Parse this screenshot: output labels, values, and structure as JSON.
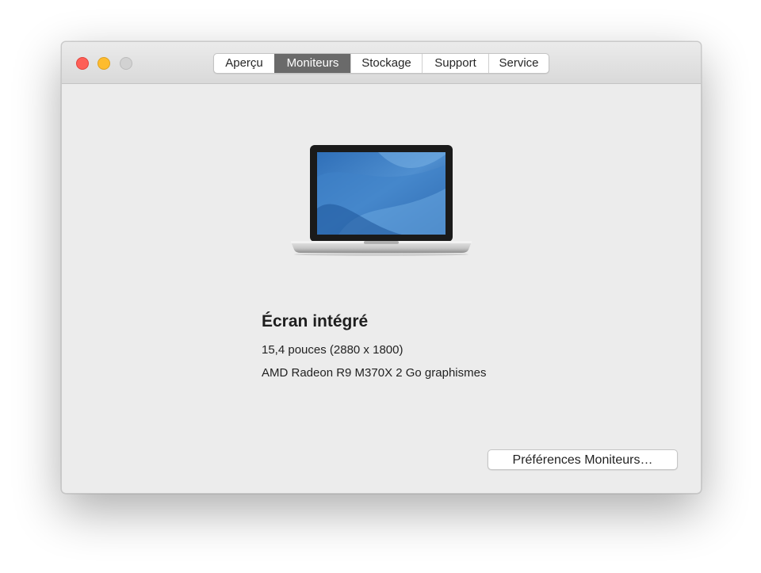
{
  "window": {
    "traffic_lights": {
      "close_color": "#fe5f57",
      "minimize_color": "#febc2e",
      "zoom_color": "#d2d2d2"
    }
  },
  "tabs": [
    {
      "label": "Aperçu",
      "active": false
    },
    {
      "label": "Moniteurs",
      "active": true
    },
    {
      "label": "Stockage",
      "active": false
    },
    {
      "label": "Support",
      "active": false
    },
    {
      "label": "Service",
      "active": false
    }
  ],
  "display": {
    "image_icon": "laptop-icon",
    "name": "Écran intégré",
    "size": "15,4 pouces (2880 x 1800)",
    "graphics": "AMD Radeon R9 M370X 2 Go graphismes"
  },
  "buttons": {
    "preferences_label": "Préférences Moniteurs…"
  },
  "colors": {
    "active_tab_bg": "#6a6a6a",
    "window_bg": "#ececec"
  }
}
